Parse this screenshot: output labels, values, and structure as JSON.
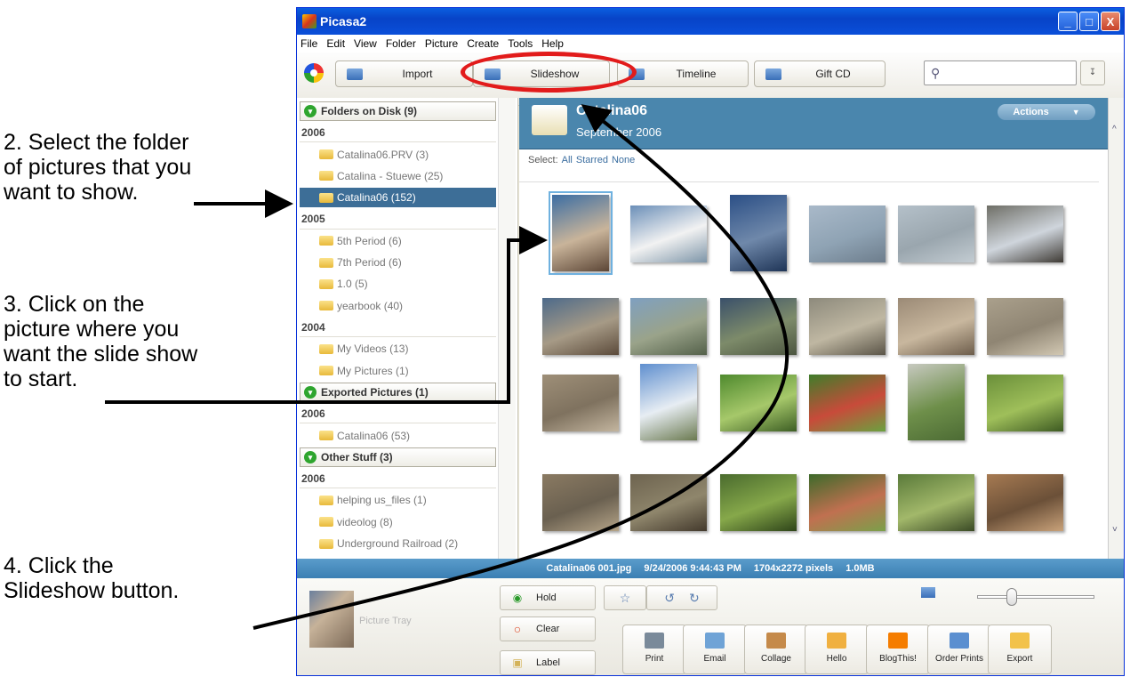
{
  "annotations": {
    "step2": "2.  Select the folder\nof pictures that you\nwant to show.",
    "step3": "3.  Click on the\npicture where you\nwant the slide show\nto start.",
    "step4": "4.  Click the\nSlideshow button."
  },
  "window": {
    "title": "Picasa2",
    "buttons": [
      "_",
      "□",
      "X"
    ]
  },
  "menu": [
    "File",
    "Edit",
    "View",
    "Folder",
    "Picture",
    "Create",
    "Tools",
    "Help"
  ],
  "toolbar": {
    "import": "Import",
    "slideshow": "Slideshow",
    "timeline": "Timeline",
    "giftcd": "Gift CD",
    "search_value": ""
  },
  "sidebar": [
    {
      "type": "head",
      "label": "Folders on Disk (9)"
    },
    {
      "type": "year",
      "label": "2006"
    },
    {
      "type": "folder",
      "label": "Catalina06.PRV (3)"
    },
    {
      "type": "folder",
      "label": "Catalina - Stuewe (25)"
    },
    {
      "type": "folder",
      "label": "Catalina06 (152)",
      "selected": true
    },
    {
      "type": "year",
      "label": "2005"
    },
    {
      "type": "folder",
      "label": "5th Period (6)"
    },
    {
      "type": "folder",
      "label": "7th Period (6)"
    },
    {
      "type": "folder",
      "label": "1.0 (5)"
    },
    {
      "type": "folder",
      "label": "yearbook (40)"
    },
    {
      "type": "year",
      "label": "2004"
    },
    {
      "type": "folder",
      "label": "My Videos (13)"
    },
    {
      "type": "folder",
      "label": "My Pictures (1)"
    },
    {
      "type": "head",
      "label": "Exported Pictures (1)"
    },
    {
      "type": "year",
      "label": "2006"
    },
    {
      "type": "folder",
      "label": "Catalina06 (53)"
    },
    {
      "type": "head",
      "label": "Other Stuff (3)"
    },
    {
      "type": "year",
      "label": "2006"
    },
    {
      "type": "folder",
      "label": "helping us_files (1)"
    },
    {
      "type": "folder",
      "label": "videolog (8)"
    },
    {
      "type": "folder",
      "label": "Underground Railroad (2)"
    }
  ],
  "folder": {
    "title": "Catalina06",
    "date": "September 2006",
    "actions": "Actions",
    "select_label": "Select:",
    "select_all": "All",
    "select_starred": "Starred",
    "select_none": "None"
  },
  "status": {
    "filename": "Catalina06 001.jpg",
    "datetime": "9/24/2006 9:44:43 PM",
    "dimensions": "1704x2272 pixels",
    "size": "1.0MB"
  },
  "tray": {
    "label": "Picture Tray",
    "hold": "Hold",
    "clear": "Clear",
    "labelbtn": "Label"
  },
  "actions": [
    {
      "label": "Print",
      "icon": "printer-icon",
      "color": "#7a8a9a"
    },
    {
      "label": "Email",
      "icon": "email-icon",
      "color": "#6fa3d6"
    },
    {
      "label": "Collage",
      "icon": "collage-icon",
      "color": "#c58a4a"
    },
    {
      "label": "Hello",
      "icon": "hello-icon",
      "color": "#f0b040"
    },
    {
      "label": "BlogThis!",
      "icon": "blogger-icon",
      "color": "#f57d00"
    },
    {
      "label": "Order Prints",
      "icon": "order-prints-icon",
      "color": "#5b8fd0"
    },
    {
      "label": "Export",
      "icon": "export-icon",
      "color": "#f2c24a"
    }
  ],
  "colors": {
    "titlebar": "#0843c7",
    "folder_header": "#4a86ad",
    "selection": "#3d6e97",
    "annotation_circle": "#e21b1b"
  }
}
